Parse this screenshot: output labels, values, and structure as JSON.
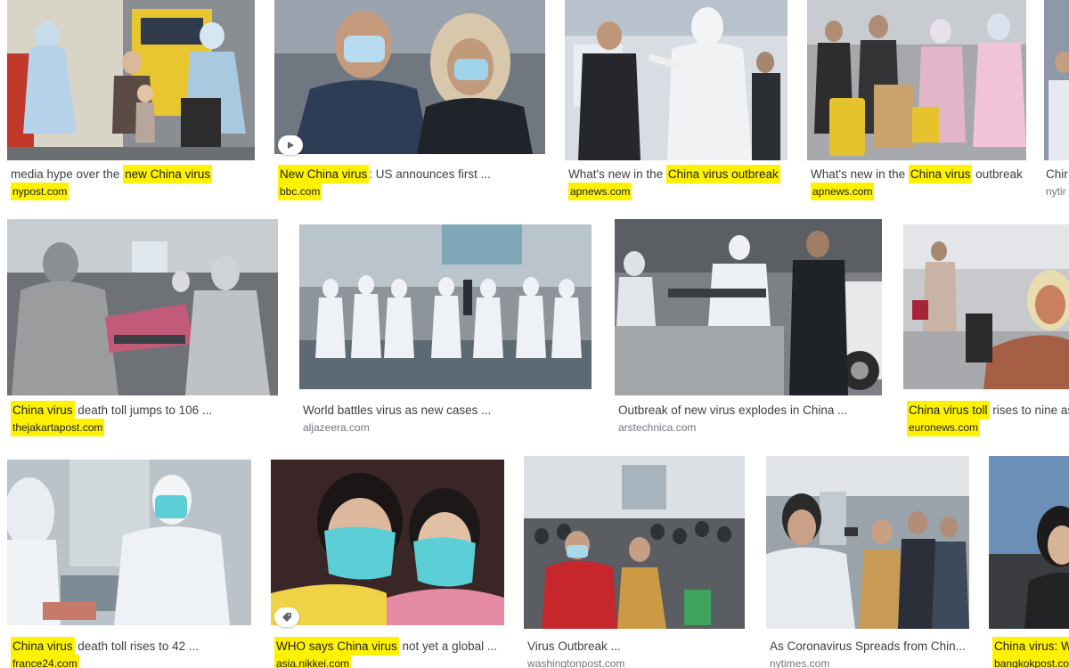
{
  "results": [
    {
      "title_pre": "media hype over the ",
      "title_hl": "new China virus",
      "title_post": "",
      "source": "nypost.com",
      "source_hl": true
    },
    {
      "title_pre": "",
      "title_hl": "New China virus",
      "title_post": ": US announces first ...",
      "source": "bbc.com",
      "source_hl": true
    },
    {
      "title_pre": "What's new in the ",
      "title_hl": "China virus outbreak",
      "title_post": "",
      "source": "apnews.com",
      "source_hl": true
    },
    {
      "title_pre": "What's new in the ",
      "title_hl": "China virus",
      "title_post": " outbreak",
      "source": "apnews.com",
      "source_hl": true
    },
    {
      "title_pre": "Chir",
      "title_hl": "",
      "title_post": "",
      "source": "nytir",
      "source_hl": false
    },
    {
      "title_pre": "",
      "title_hl": "China virus",
      "title_post": " death toll jumps to 106 ...",
      "source": "thejakartapost.com",
      "source_hl": true
    },
    {
      "title_pre": "World battles virus as new cases ...",
      "title_hl": "",
      "title_post": "",
      "source": "aljazeera.com",
      "source_hl": false
    },
    {
      "title_pre": "Outbreak of new virus explodes in China ...",
      "title_hl": "",
      "title_post": "",
      "source": "arstechnica.com",
      "source_hl": false
    },
    {
      "title_pre": "",
      "title_hl": "China virus toll",
      "title_post": " rises to nine as",
      "source": "euronews.com",
      "source_hl": true
    },
    {
      "title_pre": "",
      "title_hl": "China virus",
      "title_post": " death toll rises to 42 ...",
      "source": "france24.com",
      "source_hl": true
    },
    {
      "title_pre": "",
      "title_hl": "WHO says China virus",
      "title_post": " not yet a global ...",
      "source": "asia.nikkei.com",
      "source_hl": true
    },
    {
      "title_pre": "Virus Outbreak ...",
      "title_hl": "",
      "title_post": "",
      "source": "washingtonpost.com",
      "source_hl": false
    },
    {
      "title_pre": "As Coronavirus Spreads from Chin...",
      "title_hl": "",
      "title_post": "",
      "source": "nytimes.com",
      "source_hl": false
    },
    {
      "title_pre": "",
      "title_hl": "China virus: W",
      "title_post": "",
      "source": "bangkokpost.co",
      "source_hl": true
    }
  ],
  "badges": {
    "video_icon": "play-icon",
    "tag_icon": "tag-icon"
  },
  "colors": {
    "highlight": "#fff200",
    "title_text": "#3c4043",
    "source_text": "#70757a",
    "ppe_white": "#e8ecf2",
    "mask_teal": "#5ccfd6"
  }
}
